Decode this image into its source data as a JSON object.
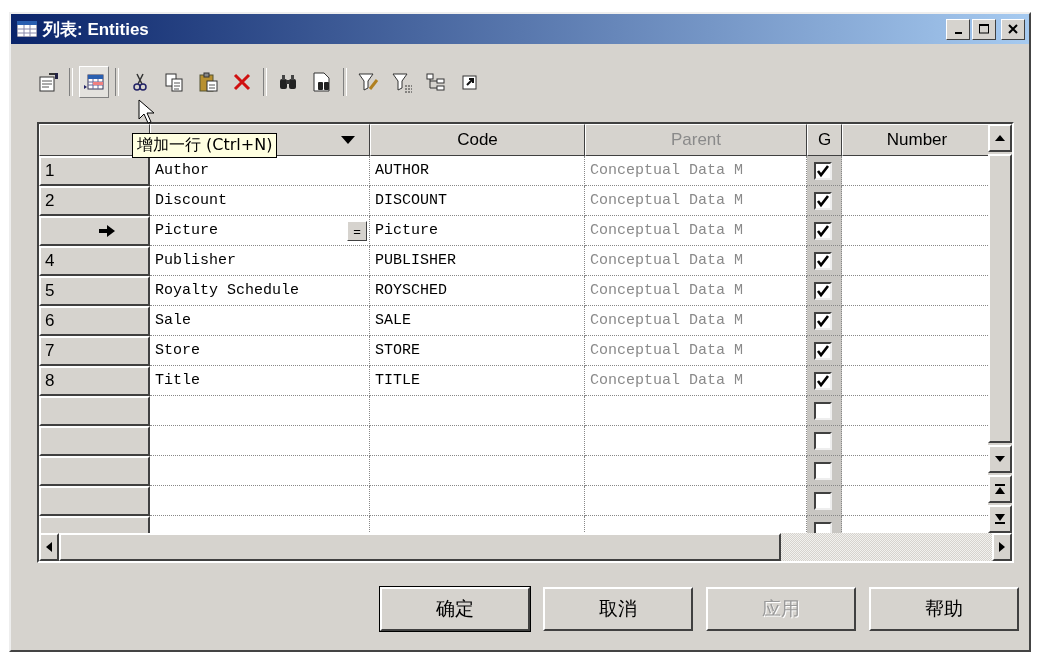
{
  "window": {
    "title": "列表: Entities"
  },
  "toolbar": [
    {
      "kind": "properties",
      "pressed": false
    },
    {
      "kind": "separator"
    },
    {
      "kind": "add-row",
      "pressed": true
    },
    {
      "kind": "separator"
    },
    {
      "kind": "cut",
      "pressed": false
    },
    {
      "kind": "copy",
      "pressed": false
    },
    {
      "kind": "paste",
      "pressed": false
    },
    {
      "kind": "delete",
      "pressed": false
    },
    {
      "kind": "separator"
    },
    {
      "kind": "find",
      "pressed": false
    },
    {
      "kind": "find-doc",
      "pressed": false
    },
    {
      "kind": "separator"
    },
    {
      "kind": "filter-edit",
      "pressed": false
    },
    {
      "kind": "filter",
      "pressed": false
    },
    {
      "kind": "tree",
      "pressed": false
    },
    {
      "kind": "export",
      "pressed": false
    }
  ],
  "tooltip": {
    "text": "增加一行 (Ctrl+N)"
  },
  "table": {
    "columns": [
      {
        "has_menu": true
      },
      {
        "label": "Code",
        "disabled": false
      },
      {
        "label": "Parent",
        "disabled": true
      },
      {
        "label": "G",
        "disabled": false
      },
      {
        "label": "Number",
        "disabled": false
      }
    ],
    "rows": [
      {
        "number": "1",
        "name": "Author",
        "code": "AUTHOR",
        "parent": "Conceptual Data M",
        "g": true,
        "current": false
      },
      {
        "number": "2",
        "name": "Discount",
        "code": "DISCOUNT",
        "parent": "Conceptual Data M",
        "g": true,
        "current": false
      },
      {
        "name": "Picture",
        "edit_button": "=",
        "code": "Picture",
        "parent": "Conceptual Data M",
        "g": true,
        "current": true
      },
      {
        "number": "4",
        "name": "Publisher",
        "code": "PUBLISHER",
        "parent": "Conceptual Data M",
        "g": true,
        "current": false
      },
      {
        "number": "5",
        "name": "Royalty Schedule",
        "code": "ROYSCHED",
        "parent": "Conceptual Data M",
        "g": true,
        "current": false
      },
      {
        "number": "6",
        "name": "Sale",
        "code": "SALE",
        "parent": "Conceptual Data M",
        "g": true,
        "current": false
      },
      {
        "number": "7",
        "name": "Store",
        "code": "STORE",
        "parent": "Conceptual Data M",
        "g": true,
        "current": false
      },
      {
        "number": "8",
        "name": "Title",
        "code": "TITLE",
        "parent": "Conceptual Data M",
        "g": true,
        "current": false
      },
      {
        "g": false,
        "current": false
      },
      {
        "g": false,
        "current": false
      },
      {
        "g": false,
        "current": false
      },
      {
        "g": false,
        "current": false
      },
      {
        "g": false,
        "current": false
      }
    ]
  },
  "buttons": [
    {
      "label": "确定",
      "default": true,
      "disabled": false
    },
    {
      "label": "取消",
      "default": false,
      "disabled": false
    },
    {
      "label": "应用",
      "default": false,
      "disabled": true
    },
    {
      "label": "帮助",
      "default": false,
      "disabled": false
    }
  ]
}
